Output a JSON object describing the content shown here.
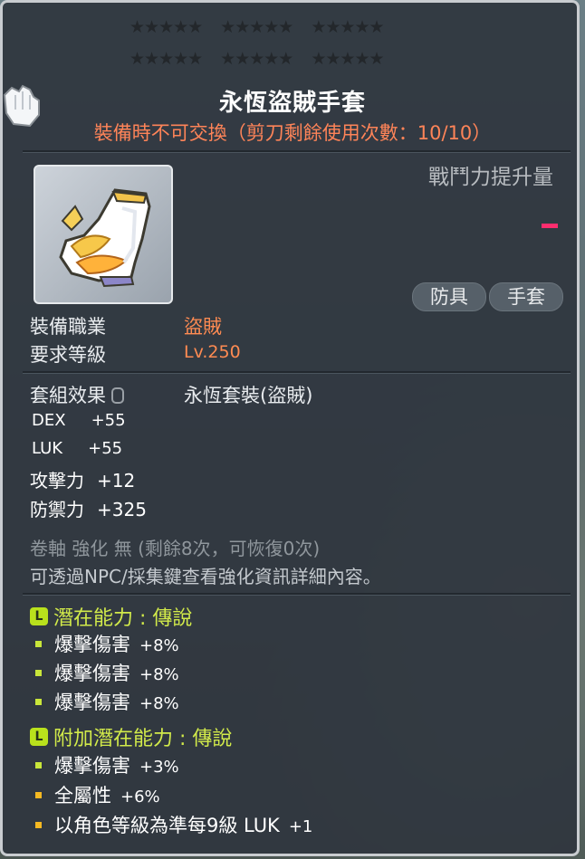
{
  "item": {
    "star_rows": [
      [
        "★★★★★",
        "★★★★★",
        "★★★★★"
      ],
      [
        "★★★★★",
        "★★★★★",
        "★★★★★"
      ]
    ],
    "name": "永恆盜賊手套",
    "trade_note": "裝備時不可交換（剪刀剩餘使用次數：10/10）",
    "combat_power_label": "戰鬥力提升量",
    "tags": [
      "防具",
      "手套"
    ],
    "job_label": "裝備職業",
    "job_value": "盜賊",
    "level_label": "要求等級",
    "level_value": "Lv.250"
  },
  "set": {
    "label": "套組效果",
    "name": "永恆套裝(盜賊)"
  },
  "stats": [
    {
      "key": "DEX",
      "value": "+55"
    },
    {
      "key": "LUK",
      "value": "+55"
    },
    {
      "key": "攻擊力",
      "value": "+12"
    },
    {
      "key": "防禦力",
      "value": "+325"
    }
  ],
  "scroll_info": "卷軸 強化 無 (剩餘8次，可恢復0次)",
  "npc_note": "可透過NPC/採集鍵查看強化資訊詳細內容。",
  "potential": {
    "badge": "L",
    "title": "潛在能力 : 傳說",
    "lines": [
      {
        "name": "爆擊傷害",
        "value": "+8%"
      },
      {
        "name": "爆擊傷害",
        "value": "+8%"
      },
      {
        "name": "爆擊傷害",
        "value": "+8%"
      }
    ]
  },
  "additional_potential": {
    "badge": "L",
    "title": "附加潛在能力 : 傳說",
    "lines": [
      {
        "name": "爆擊傷害",
        "value": "+3%",
        "color": "#c9e63a"
      },
      {
        "name": "全屬性",
        "value": "+6%",
        "color": "#f5b922"
      },
      {
        "name": "以角色等級為準每9級 LUK",
        "value": "+1",
        "color": "#f5b922"
      }
    ]
  },
  "colors": {
    "subtitle": "#ff8458",
    "orange_value": "#ff8b52",
    "legend_green": "#d2ea4a",
    "power_dash": "#ff2d6e"
  }
}
